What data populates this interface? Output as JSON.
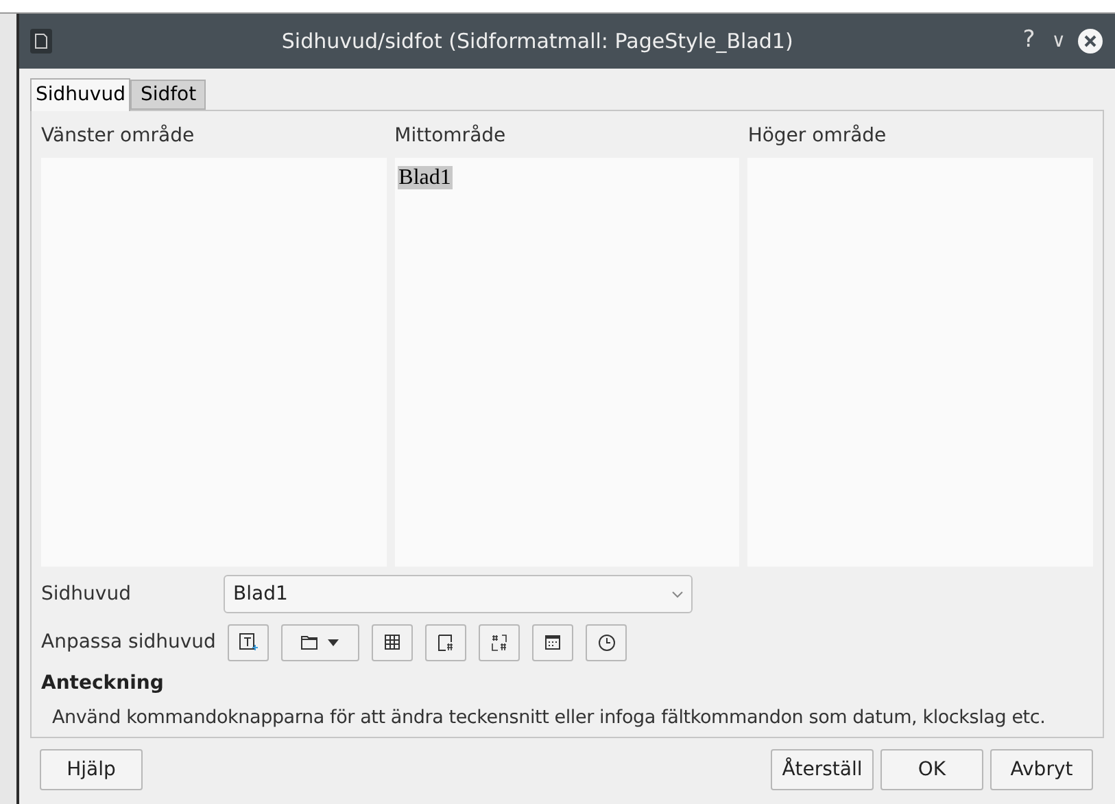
{
  "window": {
    "title": "Sidhuvud/sidfot (Sidformatmall: PageStyle_Blad1)",
    "controls": [
      "?",
      "∨"
    ]
  },
  "tabs": [
    {
      "label": "Sidhuvud",
      "selected": true
    },
    {
      "label": "Sidfot",
      "selected": false
    }
  ],
  "areas": [
    {
      "label": "Vänster område"
    },
    {
      "label": "Mittområde",
      "content": "Blad1"
    },
    {
      "label": "Höger område"
    }
  ],
  "header_select": {
    "label": "Sidhuvud",
    "value": "Blad1"
  },
  "customize": {
    "label": "Anpassa sidhuvud",
    "tools": [
      {
        "kind": "text"
      },
      {
        "kind": "file"
      },
      {
        "kind": "sheet"
      },
      {
        "kind": "page"
      },
      {
        "kind": "pages"
      },
      {
        "kind": "date"
      },
      {
        "kind": "time"
      }
    ]
  },
  "note": {
    "title": "Anteckning",
    "text": "Använd kommandoknapparna för att ändra teckensnitt eller infoga fältkommandon som datum, klockslag etc."
  },
  "buttons": {
    "left": [
      "Hjälp"
    ],
    "right": [
      "Återställ",
      "OK",
      "Avbryt"
    ]
  }
}
